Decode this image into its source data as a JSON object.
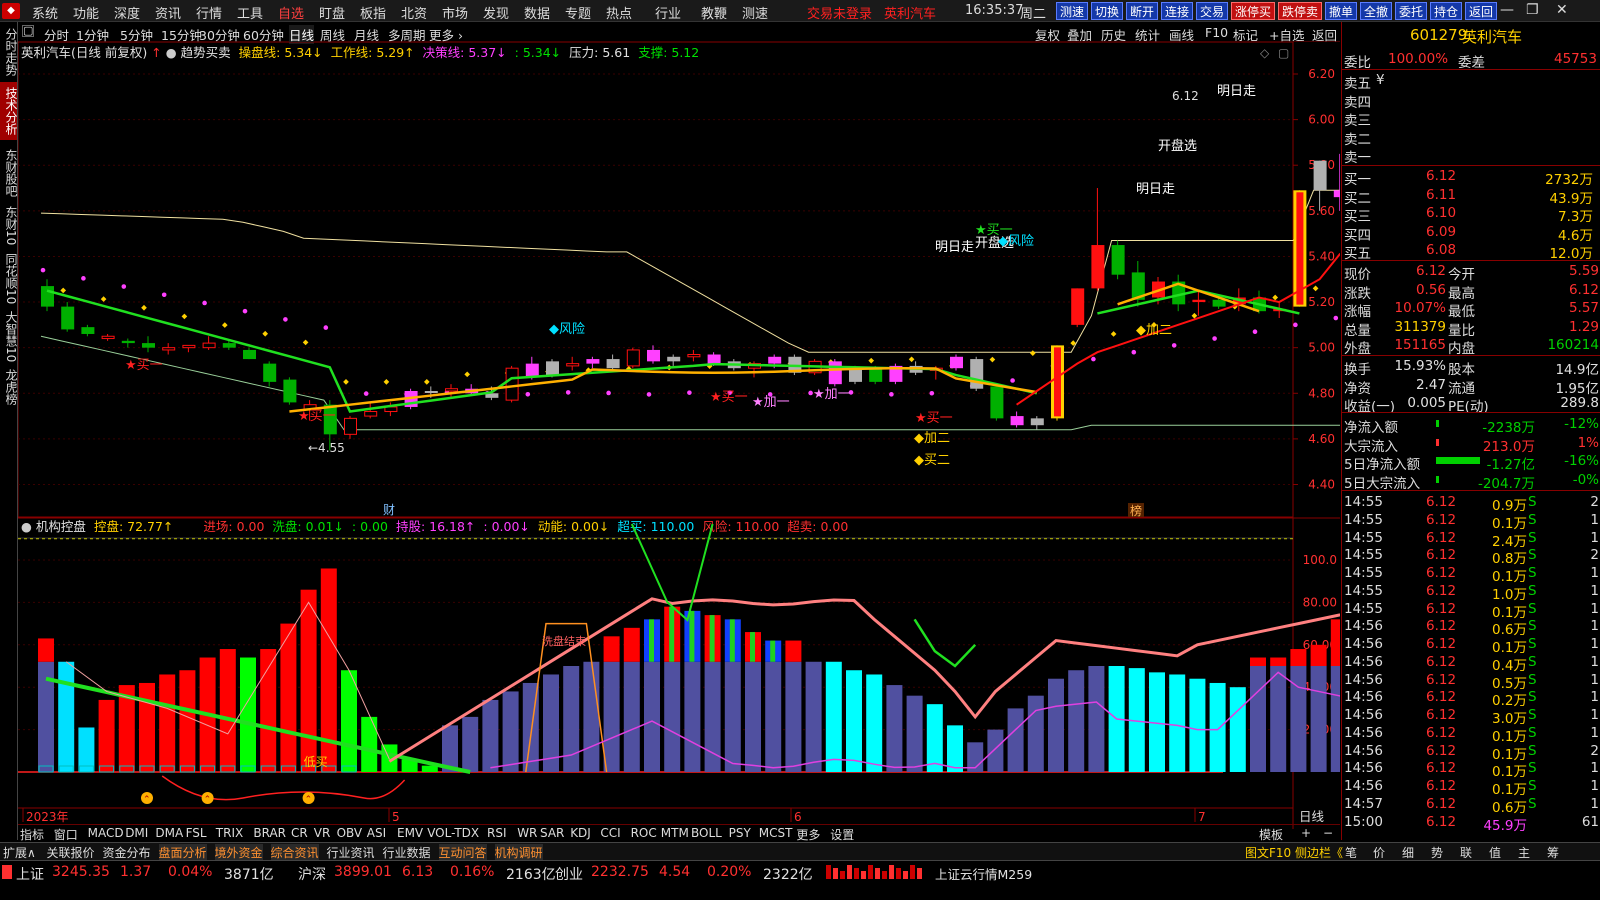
{
  "menubar": {
    "items": [
      "系统",
      "功能",
      "深度",
      "资讯",
      "行情",
      "工具",
      "自选",
      "盯盘",
      "板指",
      "北资",
      "市场",
      "发现",
      "数据",
      "专题",
      "热点",
      "行业",
      "教鞭",
      "测速"
    ],
    "active_index": 6,
    "login_text": "交易未登录",
    "stock_title": "英利汽车",
    "time": "16:35:37",
    "weekday": "周二",
    "quick_buttons": [
      "测速",
      "切换",
      "断开",
      "连接",
      "交易",
      "涨停买",
      "跌停卖",
      "撤单",
      "全撤",
      "委托",
      "持仓",
      "返回"
    ],
    "window_controls": [
      "—",
      "❐",
      "✕"
    ]
  },
  "left_tabs": [
    {
      "label": "分时走势",
      "active": false
    },
    {
      "label": "技术分析",
      "active": true
    },
    {
      "label": "东财股吧",
      "active": false
    },
    {
      "label": "东财10",
      "active": false
    },
    {
      "label": "同花顺10",
      "active": false
    },
    {
      "label": "大智慧10",
      "active": false
    },
    {
      "label": "龙虎榜",
      "active": false
    }
  ],
  "period_bar": {
    "items": [
      "分时",
      "1分钟",
      "5分钟",
      "15分钟",
      "30分钟",
      "60分钟",
      "日线",
      "周线",
      "月线",
      "多周期",
      "更多 ›"
    ],
    "active_index": 6,
    "right_tools": [
      "复权",
      "叠加",
      "历史",
      "统计",
      "画线",
      "F10",
      "标记",
      "+自选",
      "返回"
    ]
  },
  "main_indicator": {
    "stock_label": "英利汽车(日线 前复权)",
    "formula_name": "趋势买卖",
    "params": [
      {
        "label": "操盘线: 5.34↓",
        "color": "#ffd000"
      },
      {
        "label": "工作线: 5.29↑",
        "color": "#ffd000"
      },
      {
        "label": "决策线: 5.37↓",
        "color": "#ff40ff"
      },
      {
        "label": ": 5.34↓",
        "color": "#00e000"
      },
      {
        "label": "压力: 5.61",
        "color": "#e0e0e0"
      },
      {
        "label": "支撑: 5.12",
        "color": "#00e000"
      }
    ],
    "price_axis": [
      "6.20",
      "6.00",
      "5.80",
      "5.60",
      "5.40",
      "5.20",
      "5.00",
      "4.80",
      "4.60",
      "4.40"
    ],
    "annotations": {
      "low": "←4.55",
      "high": "6.12",
      "mingrizou": "明日走",
      "kaipanxuan": "开盘选",
      "fengxian": "风险",
      "mai_yi": "买一",
      "mai_er": "买二",
      "jia_yi": "加一",
      "jia_er": "加二",
      "kaipan": "开盘",
      "cai": "财",
      "bang": "榜"
    }
  },
  "sub_indicator": {
    "name": "机构控盘",
    "params": [
      {
        "label": "控盘: 72.77↑",
        "color": "#ffd000"
      },
      {
        "label": "进场: 0.00",
        "color": "#ff3030"
      },
      {
        "label": "洗盘: 0.01↓",
        "color": "#00e000"
      },
      {
        "label": ": 0.00",
        "color": "#00e000"
      },
      {
        "label": "持股: 16.18↑",
        "color": "#ff40ff"
      },
      {
        "label": ": 0.00↓",
        "color": "#ff40ff"
      },
      {
        "label": "动能: 0.00↓",
        "color": "#ffd000"
      },
      {
        "label": "超买: 110.00",
        "color": "#00e0ff"
      },
      {
        "label": "风险: 110.00",
        "color": "#ff3030"
      },
      {
        "label": "超卖: 0.00",
        "color": "#ff3030"
      }
    ],
    "axis": [
      "100.0",
      "80.00",
      "60.00",
      "40.00",
      "20.00"
    ],
    "low_buy_label": "低买",
    "wash_label": "洗盘结束"
  },
  "date_axis": {
    "labels": [
      "2023年",
      "5",
      "6",
      "7"
    ],
    "right_label": "日线"
  },
  "chart_data": {
    "type": "candlestick",
    "ylim": [
      4.35,
      6.25
    ],
    "candles": [
      [
        5.27,
        5.3,
        5.16,
        5.18
      ],
      [
        5.18,
        5.2,
        5.07,
        5.08
      ],
      [
        5.09,
        5.1,
        5.05,
        5.06
      ],
      [
        5.04,
        5.06,
        5.03,
        5.05
      ],
      [
        5.03,
        5.04,
        5.0,
        5.02
      ],
      [
        5.02,
        5.05,
        4.98,
        5.0
      ],
      [
        4.99,
        5.02,
        4.97,
        5.0
      ],
      [
        5.0,
        5.01,
        4.98,
        5.01
      ],
      [
        5.0,
        5.05,
        4.99,
        5.02
      ],
      [
        5.02,
        5.03,
        4.99,
        5.0
      ],
      [
        4.99,
        5.0,
        4.95,
        4.95
      ],
      [
        4.93,
        4.94,
        4.83,
        4.85
      ],
      [
        4.86,
        4.87,
        4.75,
        4.76
      ],
      [
        4.73,
        4.77,
        4.68,
        4.75
      ],
      [
        4.75,
        4.77,
        4.55,
        4.62
      ],
      [
        4.62,
        4.7,
        4.6,
        4.69
      ],
      [
        4.7,
        4.76,
        4.69,
        4.72
      ],
      [
        4.72,
        4.76,
        4.7,
        4.74
      ],
      [
        4.74,
        4.82,
        4.73,
        4.81
      ],
      [
        4.81,
        4.83,
        4.78,
        4.81
      ],
      [
        4.81,
        4.84,
        4.78,
        4.82
      ],
      [
        4.82,
        4.84,
        4.79,
        4.8
      ],
      [
        4.8,
        4.83,
        4.77,
        4.78
      ],
      [
        4.77,
        4.92,
        4.76,
        4.91
      ],
      [
        4.93,
        4.96,
        4.86,
        4.87
      ],
      [
        4.88,
        4.95,
        4.87,
        4.94
      ],
      [
        4.92,
        4.96,
        4.9,
        4.93
      ],
      [
        4.93,
        4.96,
        4.91,
        4.95
      ],
      [
        4.95,
        4.97,
        4.9,
        4.91
      ],
      [
        4.92,
        5.0,
        4.91,
        4.99
      ],
      [
        4.99,
        5.01,
        4.93,
        4.94
      ],
      [
        4.94,
        4.97,
        4.92,
        4.96
      ],
      [
        4.96,
        4.99,
        4.94,
        4.97
      ],
      [
        4.97,
        4.98,
        4.92,
        4.93
      ],
      [
        4.94,
        4.95,
        4.9,
        4.91
      ],
      [
        4.91,
        4.94,
        4.87,
        4.93
      ],
      [
        4.93,
        4.97,
        4.91,
        4.96
      ],
      [
        4.96,
        4.97,
        4.88,
        4.89
      ],
      [
        4.89,
        4.95,
        4.88,
        4.94
      ],
      [
        4.94,
        4.95,
        4.83,
        4.84
      ],
      [
        4.85,
        4.92,
        4.84,
        4.91
      ],
      [
        4.91,
        4.92,
        4.84,
        4.85
      ],
      [
        4.85,
        4.93,
        4.84,
        4.92
      ],
      [
        4.92,
        4.94,
        4.88,
        4.89
      ],
      [
        4.9,
        4.92,
        4.86,
        4.91
      ],
      [
        4.91,
        4.97,
        4.9,
        4.96
      ],
      [
        4.95,
        4.96,
        4.81,
        4.82
      ],
      [
        4.83,
        4.84,
        4.68,
        4.69
      ],
      [
        4.7,
        4.72,
        4.65,
        4.66
      ],
      [
        4.66,
        4.7,
        4.64,
        4.69
      ],
      [
        4.69,
        5.01,
        4.68,
        5.01
      ],
      [
        5.1,
        5.26,
        5.09,
        5.26
      ],
      [
        5.26,
        5.7,
        5.25,
        5.45
      ],
      [
        5.45,
        5.47,
        5.3,
        5.32
      ],
      [
        5.33,
        5.38,
        5.18,
        5.21
      ],
      [
        5.22,
        5.31,
        5.19,
        5.29
      ],
      [
        5.29,
        5.32,
        5.16,
        5.19
      ],
      [
        5.2,
        5.25,
        5.14,
        5.21
      ],
      [
        5.21,
        5.23,
        5.17,
        5.18
      ],
      [
        5.19,
        5.26,
        5.16,
        5.22
      ],
      [
        5.22,
        5.25,
        5.15,
        5.16
      ],
      [
        5.16,
        5.2,
        5.13,
        5.17
      ],
      [
        5.18,
        5.69,
        5.18,
        5.69
      ],
      [
        5.69,
        5.82,
        5.6,
        5.82
      ],
      [
        5.69,
        5.85,
        5.6,
        5.66
      ],
      [
        5.66,
        5.67,
        5.62,
        5.63
      ],
      [
        5.63,
        5.75,
        5.59,
        5.68
      ],
      [
        5.59,
        6.12,
        5.59,
        6.12
      ]
    ],
    "legend": [
      "操盘线",
      "工作线",
      "决策线",
      "压力",
      "支撑"
    ]
  },
  "sub_chart_data": {
    "type": "bar",
    "ylim": [
      0,
      125
    ],
    "bars": [
      [
        52,
        11,
        "#5050a0"
      ],
      [
        52,
        0,
        "#00e0ff"
      ],
      [
        21,
        0,
        "#00e0ff"
      ],
      [
        34,
        0,
        "#ff0000"
      ],
      [
        41,
        0,
        "#ff0000"
      ],
      [
        42,
        0,
        "#ff0000"
      ],
      [
        46,
        0,
        "#ff0000"
      ],
      [
        48,
        0,
        "#ff0000"
      ],
      [
        54,
        0,
        "#ff0000"
      ],
      [
        58,
        0,
        "#ff0000"
      ],
      [
        54,
        0,
        "#00ff00"
      ],
      [
        58,
        0,
        "#ff0000"
      ],
      [
        70,
        0,
        "#ff0000"
      ],
      [
        86,
        0,
        "#ff0000"
      ],
      [
        96,
        0,
        "#ff0000"
      ],
      [
        48,
        0,
        "#00ff00"
      ],
      [
        26,
        0,
        "#00ff00"
      ],
      [
        13,
        0,
        "#00ff00"
      ],
      [
        6,
        0,
        "#00ff00"
      ],
      [
        3,
        0,
        "#00ff00"
      ],
      [
        22,
        0,
        "#5050a0"
      ],
      [
        26,
        0,
        "#5050a0"
      ],
      [
        34,
        0,
        "#5050a0"
      ],
      [
        38,
        0,
        "#5050a0"
      ],
      [
        42,
        0,
        "#5050a0"
      ],
      [
        46,
        0,
        "#5050a0"
      ],
      [
        50,
        0,
        "#5050a0"
      ],
      [
        52,
        0,
        "#5050a0"
      ],
      [
        52,
        12,
        "#5050a0"
      ],
      [
        52,
        16,
        "#5050a0"
      ],
      [
        52,
        20,
        "#5050a0"
      ],
      [
        52,
        26,
        "#5050a0"
      ],
      [
        52,
        24,
        "#5050a0"
      ],
      [
        52,
        22,
        "#5050a0"
      ],
      [
        52,
        20,
        "#5050a0"
      ],
      [
        52,
        14,
        "#5050a0"
      ],
      [
        52,
        10,
        "#5050a0"
      ],
      [
        52,
        10,
        "#5050a0"
      ],
      [
        52,
        0,
        "#5050a0"
      ],
      [
        52,
        0,
        "#00ffff"
      ],
      [
        48,
        0,
        "#00ffff"
      ],
      [
        46,
        0,
        "#00ffff"
      ],
      [
        41,
        0,
        "#5050a0"
      ],
      [
        36,
        0,
        "#5050a0"
      ],
      [
        32,
        0,
        "#00ffff"
      ],
      [
        22,
        0,
        "#00ffff"
      ],
      [
        14,
        0,
        "#5050a0"
      ],
      [
        20,
        0,
        "#5050a0"
      ],
      [
        30,
        0,
        "#5050a0"
      ],
      [
        36,
        0,
        "#5050a0"
      ],
      [
        44,
        0,
        "#5050a0"
      ],
      [
        48,
        0,
        "#5050a0"
      ],
      [
        50,
        0,
        "#5050a0"
      ],
      [
        50,
        0,
        "#00ffff"
      ],
      [
        49,
        0,
        "#00ffff"
      ],
      [
        47,
        0,
        "#00ffff"
      ],
      [
        46,
        0,
        "#00ffff"
      ],
      [
        44,
        0,
        "#00ffff"
      ],
      [
        42,
        0,
        "#00ffff"
      ],
      [
        40,
        0,
        "#00ffff"
      ],
      [
        50,
        4,
        "#5050a0"
      ],
      [
        50,
        4,
        "#5050a0"
      ],
      [
        50,
        8,
        "#5050a0"
      ],
      [
        50,
        10,
        "#5050a0"
      ],
      [
        50,
        22,
        "#5050a0"
      ]
    ]
  },
  "quote_panel": {
    "code": "601279",
    "name": "英利汽车",
    "weibi_label": "委比",
    "weibi_value": "100.00%",
    "weicha_label": "委差",
    "weicha_value": "45753",
    "asks": [
      {
        "label": "卖五",
        "price": "¥",
        "vol": ""
      },
      {
        "label": "卖四",
        "price": "",
        "vol": ""
      },
      {
        "label": "卖三",
        "price": "",
        "vol": ""
      },
      {
        "label": "卖二",
        "price": "",
        "vol": ""
      },
      {
        "label": "卖一",
        "price": "",
        "vol": ""
      }
    ],
    "bids": [
      {
        "label": "买一",
        "price": "6.12",
        "vol": "2732万"
      },
      {
        "label": "买二",
        "price": "6.11",
        "vol": "43.9万"
      },
      {
        "label": "买三",
        "price": "6.10",
        "vol": "7.3万"
      },
      {
        "label": "买四",
        "price": "6.09",
        "vol": "4.6万"
      },
      {
        "label": "买五",
        "price": "6.08",
        "vol": "12.0万"
      }
    ],
    "stats": [
      {
        "l1": "现价",
        "v1": "6.12",
        "c1": "#ff3030",
        "l2": "今开",
        "v2": "5.59",
        "c2": "#ff3030"
      },
      {
        "l1": "涨跌",
        "v1": "0.56",
        "c1": "#ff3030",
        "l2": "最高",
        "v2": "6.12",
        "c2": "#ff3030"
      },
      {
        "l1": "涨幅",
        "v1": "10.07%",
        "c1": "#ff3030",
        "l2": "最低",
        "v2": "5.57",
        "c2": "#ff3030"
      },
      {
        "l1": "总量",
        "v1": "311379",
        "c1": "#ffd000",
        "l2": "量比",
        "v2": "1.29",
        "c2": "#ff3030"
      },
      {
        "l1": "外盘",
        "v1": "151165",
        "c1": "#ff3030",
        "l2": "内盘",
        "v2": "160214",
        "c2": "#00d000"
      },
      {
        "l1": "换手",
        "v1": "15.93%",
        "c1": "#e0e0e0",
        "l2": "股本",
        "v2": "14.9亿",
        "c2": "#e0e0e0"
      },
      {
        "l1": "净资",
        "v1": "2.47",
        "c1": "#e0e0e0",
        "l2": "流通",
        "v2": "1.95亿",
        "c2": "#e0e0e0"
      },
      {
        "l1": "收益(一)",
        "v1": "0.005",
        "c1": "#e0e0e0",
        "l2": "PE(动)",
        "v2": "289.8",
        "c2": "#e0e0e0"
      }
    ],
    "flows": [
      {
        "label": "净流入额",
        "value": "-2238万",
        "pct": "-12%",
        "color": "#00d000",
        "bar": 0.05
      },
      {
        "label": "大宗流入",
        "value": "213.0万",
        "pct": "1%",
        "color": "#ff3030",
        "bar": 0.02
      },
      {
        "label": "5日净流入额",
        "value": "-1.27亿",
        "pct": "-16%",
        "color": "#00d000",
        "bar": 0.75
      },
      {
        "label": "5日大宗流入",
        "value": "-204.7万",
        "pct": "-0%",
        "color": "#00d000",
        "bar": 0
      }
    ],
    "ticks": [
      [
        "14:55",
        "6.12",
        "0.9万",
        "S",
        "2"
      ],
      [
        "14:55",
        "6.12",
        "0.1万",
        "S",
        "1"
      ],
      [
        "14:55",
        "6.12",
        "2.4万",
        "S",
        "1"
      ],
      [
        "14:55",
        "6.12",
        "0.8万",
        "S",
        "2"
      ],
      [
        "14:55",
        "6.12",
        "0.1万",
        "S",
        "1"
      ],
      [
        "14:55",
        "6.12",
        "1.0万",
        "S",
        "1"
      ],
      [
        "14:55",
        "6.12",
        "0.1万",
        "S",
        "1"
      ],
      [
        "14:56",
        "6.12",
        "0.6万",
        "S",
        "1"
      ],
      [
        "14:56",
        "6.12",
        "0.1万",
        "S",
        "1"
      ],
      [
        "14:56",
        "6.12",
        "0.4万",
        "S",
        "1"
      ],
      [
        "14:56",
        "6.12",
        "0.5万",
        "S",
        "1"
      ],
      [
        "14:56",
        "6.12",
        "0.2万",
        "S",
        "1"
      ],
      [
        "14:56",
        "6.12",
        "3.0万",
        "S",
        "1"
      ],
      [
        "14:56",
        "6.12",
        "0.1万",
        "S",
        "1"
      ],
      [
        "14:56",
        "6.12",
        "0.1万",
        "S",
        "2"
      ],
      [
        "14:56",
        "6.12",
        "0.1万",
        "S",
        "1"
      ],
      [
        "14:56",
        "6.12",
        "0.1万",
        "S",
        "1"
      ],
      [
        "14:57",
        "6.12",
        "0.6万",
        "S",
        "1"
      ],
      [
        "15:00",
        "6.12",
        "45.9万",
        "",
        "61"
      ]
    ]
  },
  "indicator_tabs": [
    "指标",
    "窗口",
    "MACD",
    "DMI",
    "DMA",
    "FSL",
    "TRIX",
    "BRAR",
    "CR",
    "VR",
    "OBV",
    "ASI",
    "EMV",
    "VOL-TDX",
    "RSI",
    "WR",
    "SAR",
    "KDJ",
    "CCI",
    "ROC",
    "MTM",
    "BOLL",
    "PSY",
    "MCST",
    "更多",
    "设置"
  ],
  "indicator_right": [
    "模板",
    "+",
    "−"
  ],
  "expand_bar": {
    "items": [
      "扩展∧",
      "关联报价",
      "资金分布",
      "盘面分析",
      "境外资金",
      "综合资讯",
      "行业资讯",
      "行业数据",
      "互动问答",
      "机构调研"
    ],
    "highlight": [
      3,
      4,
      5,
      8,
      9
    ],
    "right_text": "图文F10 侧边栏《",
    "right_icons": [
      "笔",
      "价",
      "细",
      "势",
      "联",
      "值",
      "主",
      "筹"
    ]
  },
  "status_bar": [
    {
      "name": "上证",
      "value": "3245.35",
      "chg": "1.37",
      "pct": "0.04%",
      "amt": "3871亿"
    },
    {
      "name": "沪深",
      "value": "3899.01",
      "chg": "6.13",
      "pct": "0.16%",
      "amt": "2163亿"
    },
    {
      "name": "创业",
      "value": "2232.75",
      "chg": "4.54",
      "pct": "0.20%",
      "amt": "2322亿"
    }
  ],
  "status_right": "上证云行情M259"
}
